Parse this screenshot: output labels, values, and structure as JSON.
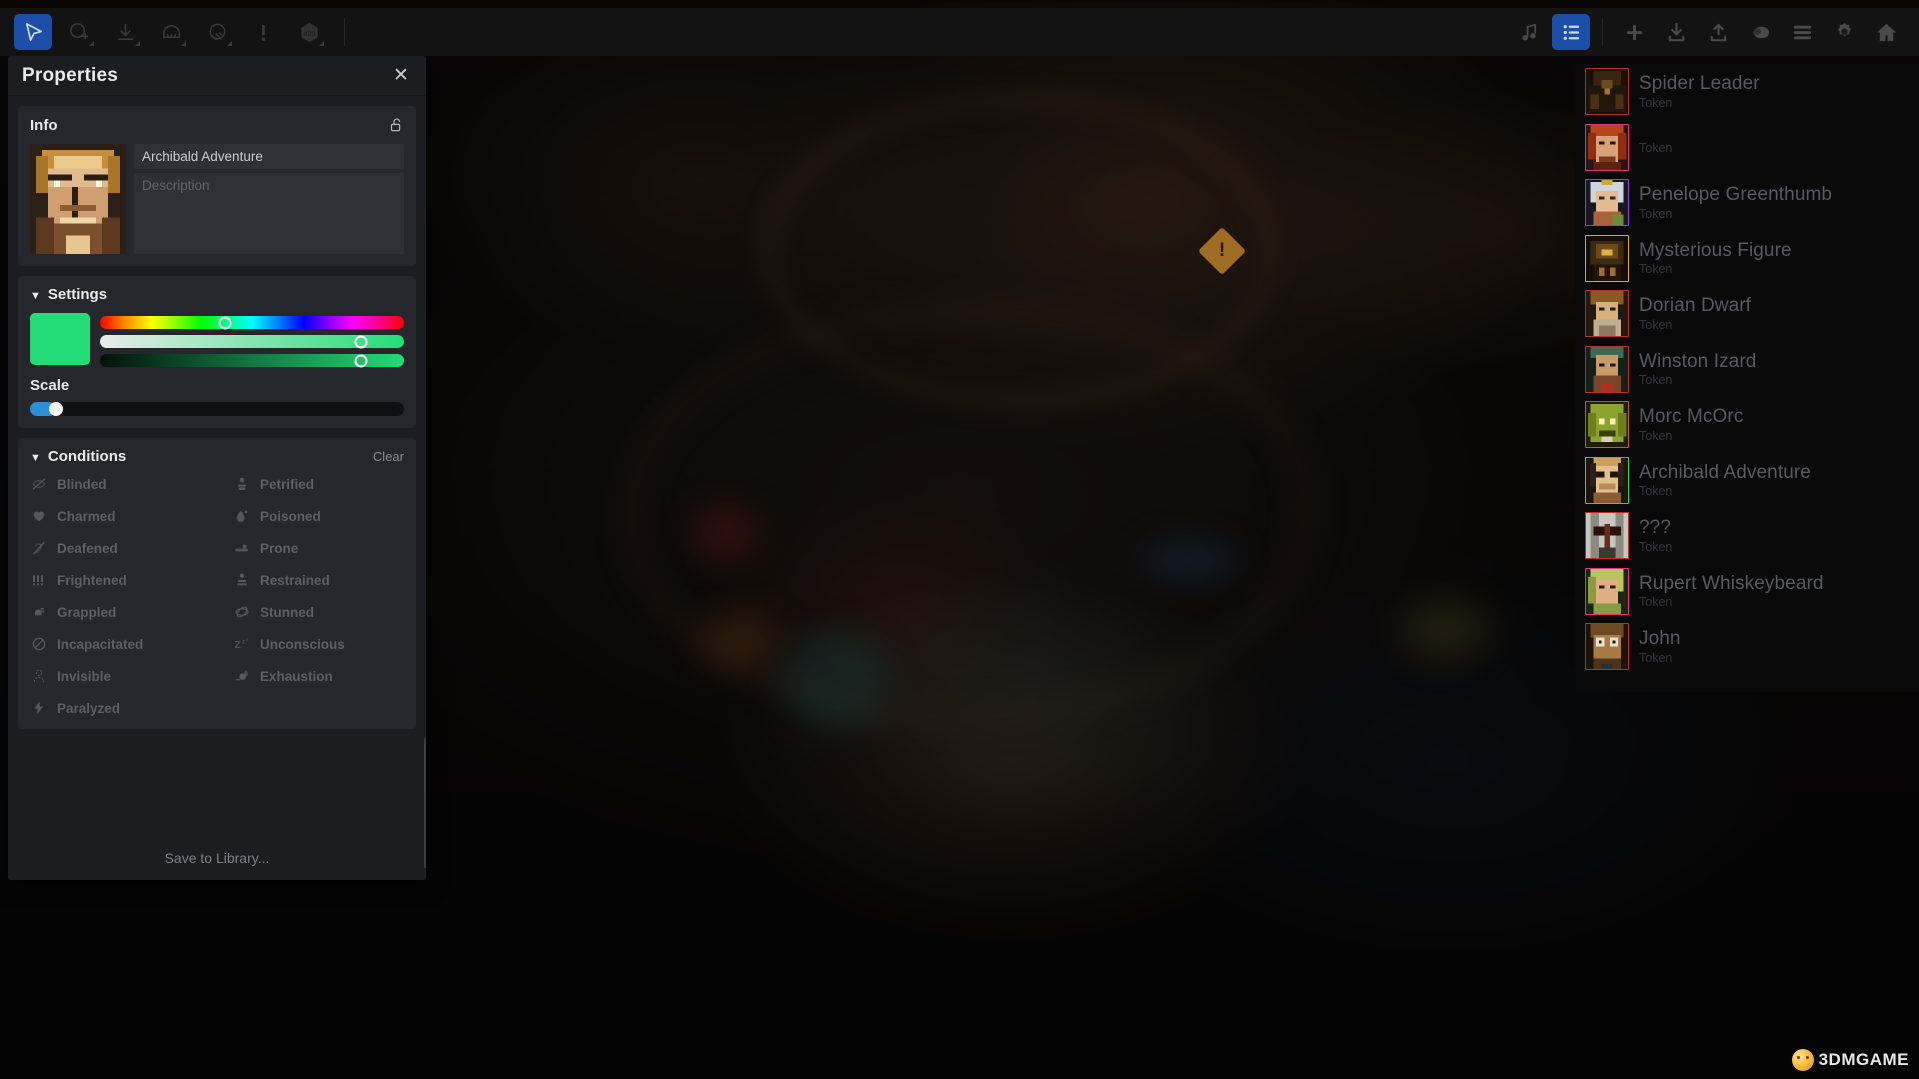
{
  "toolbar": {
    "left_tools": [
      {
        "name": "select-tool",
        "icon": "cursor-arrow-icon",
        "active": true
      },
      {
        "name": "fog-reveal-tool",
        "icon": "fog-add-icon",
        "active": false
      },
      {
        "name": "import-tool",
        "icon": "download-arrow-icon",
        "active": false
      },
      {
        "name": "token-tool",
        "icon": "token-stamp-icon",
        "active": false
      },
      {
        "name": "fog-hide-tool",
        "icon": "fog-hide-icon",
        "active": false
      },
      {
        "name": "alert-tool",
        "icon": "exclamation-icon",
        "active": false
      },
      {
        "name": "dice-tool",
        "icon": "d20-dice-icon",
        "active": false
      }
    ],
    "right_tools": [
      {
        "name": "music-button",
        "icon": "music-note-icon",
        "active": false
      },
      {
        "name": "token-list-button",
        "icon": "list-items-icon",
        "active": true
      },
      {
        "name": "add-button",
        "icon": "plus-icon",
        "active": false
      },
      {
        "name": "download-button",
        "icon": "download-tray-icon",
        "active": false
      },
      {
        "name": "upload-button",
        "icon": "upload-tray-icon",
        "active": false
      },
      {
        "name": "fog-button",
        "icon": "cloud-fog-icon",
        "active": false
      },
      {
        "name": "menu-button",
        "icon": "hamburger-menu-icon",
        "active": false
      },
      {
        "name": "settings-button",
        "icon": "gear-icon",
        "active": false
      },
      {
        "name": "home-button",
        "icon": "home-icon",
        "active": false
      }
    ]
  },
  "panel": {
    "title": "Properties",
    "close_label": "✕",
    "info": {
      "section_title": "Info",
      "lock_icon": "unlocked-padlock-icon",
      "name_value": "Archibald Adventure",
      "description_placeholder": "Description",
      "description_value": ""
    },
    "settings": {
      "section_title": "Settings",
      "swatch_color": "#22dd77",
      "hue_knob_percent": 41,
      "saturation_knob_percent": 86,
      "value_knob_percent": 86
    },
    "scale": {
      "label": "Scale",
      "value_percent": 7,
      "fill_color": "#2d8fd8"
    },
    "conditions": {
      "section_title": "Conditions",
      "clear_label": "Clear",
      "column_left": [
        {
          "label": "Blinded",
          "icon": "blinded-eye-slash-icon"
        },
        {
          "label": "Charmed",
          "icon": "charmed-heart-icon"
        },
        {
          "label": "Deafened",
          "icon": "deafened-ear-slash-icon"
        },
        {
          "label": "Frightened",
          "icon": "frightened-bars-icon"
        },
        {
          "label": "Grappled",
          "icon": "grappled-hand-icon"
        },
        {
          "label": "Incapacitated",
          "icon": "incapacitated-no-entry-icon"
        },
        {
          "label": "Invisible",
          "icon": "invisible-outline-icon"
        },
        {
          "label": "Paralyzed",
          "icon": "paralyzed-bolt-icon"
        }
      ],
      "column_right": [
        {
          "label": "Petrified",
          "icon": "petrified-statue-icon"
        },
        {
          "label": "Poisoned",
          "icon": "poisoned-droplet-icon"
        },
        {
          "label": "Prone",
          "icon": "prone-person-icon"
        },
        {
          "label": "Restrained",
          "icon": "restrained-person-icon"
        },
        {
          "label": "Stunned",
          "icon": "stunned-swirl-icon"
        },
        {
          "label": "Unconscious",
          "icon": "unconscious-zzz-icon"
        },
        {
          "label": "Exhaustion",
          "icon": "exhaustion-sweat-icon"
        }
      ]
    },
    "save_to_library_label": "Save to Library..."
  },
  "token_list": [
    {
      "name": "Spider Leader",
      "type": "Token",
      "border_color": "#b5302c",
      "selected": false,
      "thumb": "spider-leader-portrait"
    },
    {
      "name": "",
      "type": "Token",
      "border_color": "#e0357f",
      "selected": false,
      "thumb": "red-haired-woman-portrait"
    },
    {
      "name": "Penelope Greenthumb",
      "type": "Token",
      "border_color": "#8a44d6",
      "selected": false,
      "thumb": "penelope-portrait"
    },
    {
      "name": "Mysterious Figure",
      "type": "Token",
      "border_color": "#d4b02a",
      "selected": false,
      "thumb": "mysterious-figure-portrait"
    },
    {
      "name": "Dorian Dwarf",
      "type": "Token",
      "border_color": "#b5302c",
      "selected": false,
      "thumb": "dorian-dwarf-portrait"
    },
    {
      "name": "Winston Izard",
      "type": "Token",
      "border_color": "#b5302c",
      "selected": false,
      "thumb": "winston-izard-portrait"
    },
    {
      "name": "Morc McOrc",
      "type": "Token",
      "border_color": "#c0601f",
      "selected": false,
      "thumb": "morc-mcorc-portrait"
    },
    {
      "name": "Archibald Adventure",
      "type": "Token",
      "border_color": "#2bd47a",
      "selected": true,
      "thumb": "archibald-portrait"
    },
    {
      "name": "???",
      "type": "Token",
      "border_color": "#b5302c",
      "selected": false,
      "thumb": "unknown-masked-portrait"
    },
    {
      "name": "Rupert Whiskeybeard",
      "type": "Token",
      "border_color": "#e0357f",
      "selected": false,
      "thumb": "rupert-portrait"
    },
    {
      "name": "John",
      "type": "Token",
      "border_color": "#b5302c",
      "selected": false,
      "thumb": "john-portrait"
    }
  ],
  "map": {
    "warning_marker_label": "!"
  },
  "watermark": {
    "text": "3DMGAME",
    "icon": "smiley-ball-icon"
  }
}
